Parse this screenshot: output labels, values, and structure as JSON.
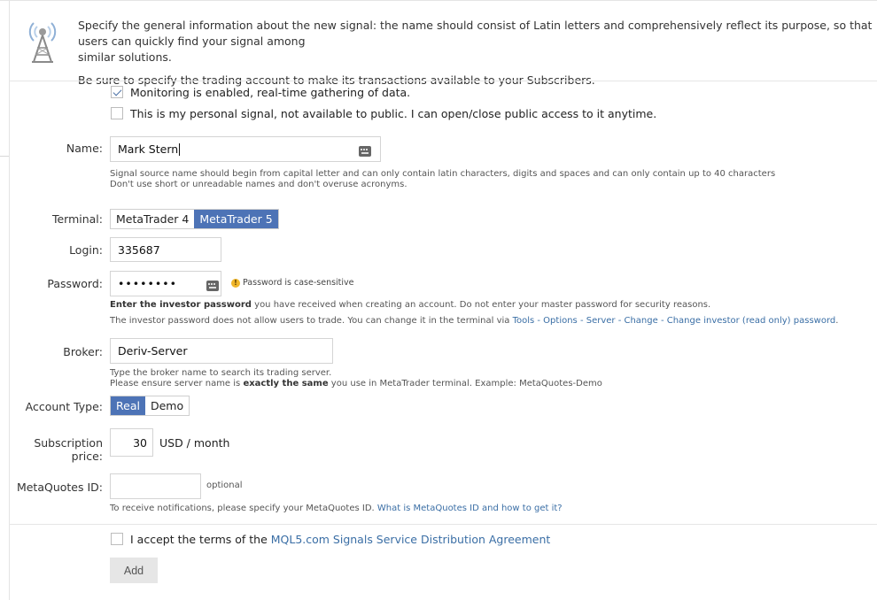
{
  "intro": {
    "line1": "Specify the general information about the new signal: the name should consist of Latin letters and comprehensively reflect its purpose, so that users can quickly find your signal among",
    "line1_cont": "similar solutions.",
    "line2": "Be sure to specify the trading account to make its transactions available to your Subscribers."
  },
  "icon": "signal-antenna-icon",
  "monitoring": {
    "label": "Monitoring is enabled, real-time gathering of data.",
    "checked": true
  },
  "personal": {
    "label": "This is my personal signal, not available to public. I can open/close public access to it anytime.",
    "checked": false
  },
  "name": {
    "label": "Name:",
    "value": "Mark Stern",
    "hint1": "Signal source name should begin from capital letter and can only contain latin characters, digits and spaces and can only contain up to 40 characters",
    "hint2": "Don't use short or unreadable names and don't overuse acronyms."
  },
  "terminal": {
    "label": "Terminal:",
    "options": [
      "MetaTrader 4",
      "MetaTrader 5"
    ],
    "selected": "MetaTrader 5"
  },
  "login": {
    "label": "Login:",
    "value": "335687"
  },
  "password": {
    "label": "Password:",
    "value": "••••••••",
    "warning": "Password is case-sensitive",
    "hint1_bold": "Enter the investor password",
    "hint1_rest": " you have received when creating an account. Do not enter your master password for security reasons.",
    "hint2_pre": "The investor password does not allow users to trade. You can change it in the terminal via ",
    "hint2_link": "Tools - Options - Server - Change - Change investor (read only) password",
    "hint2_post": "."
  },
  "broker": {
    "label": "Broker:",
    "value": "Deriv-Server",
    "hint1": "Type the broker name to search its trading server.",
    "hint2_pre": "Please ensure server name is ",
    "hint2_bold": "exactly the same",
    "hint2_post": " you use in MetaTrader terminal. Example: MetaQuotes-Demo"
  },
  "account_type": {
    "label": "Account Type:",
    "options": [
      "Real",
      "Demo"
    ],
    "selected": "Real"
  },
  "price": {
    "label": "Subscription price:",
    "value": "30",
    "unit": "USD / month"
  },
  "metaquotes": {
    "label": "MetaQuotes ID:",
    "value": "",
    "optional": "optional",
    "hint_pre": "To receive notifications, please specify your MetaQuotes ID. ",
    "hint_link": "What is MetaQuotes ID and how to get it?"
  },
  "terms": {
    "label_pre": "I accept the terms of the ",
    "label_link": "MQL5.com Signals Service Distribution Agreement",
    "checked": false
  },
  "add_button": "Add",
  "colors": {
    "accent": "#4d73b6",
    "link": "#3a6ea5",
    "button_bg": "#e6e6e6"
  }
}
